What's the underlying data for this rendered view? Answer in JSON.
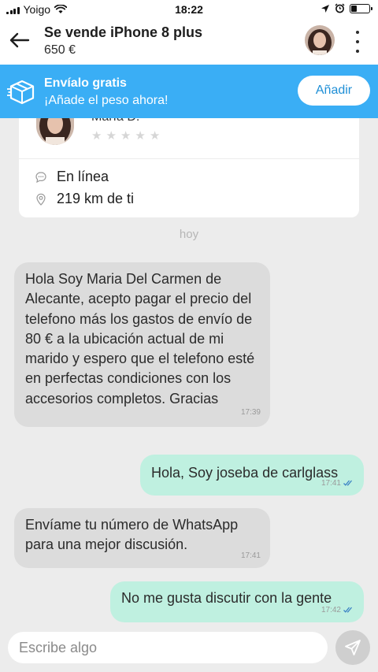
{
  "status_bar": {
    "carrier": "Yoigo",
    "time": "18:22"
  },
  "header": {
    "title": "Se vende iPhone 8 plus",
    "price": "650 €"
  },
  "banner": {
    "title": "Envíalo gratis",
    "subtitle": "¡Añade el peso ahora!",
    "button_label": "Añadir",
    "color": "#3aaef5"
  },
  "profile": {
    "name": "María D.",
    "rating_stars": 0,
    "status": "En línea",
    "distance": "219 km de ti"
  },
  "date_separator": "hoy",
  "messages": [
    {
      "direction": "in",
      "text": "Hola Soy Maria Del Carmen de Alecante, acepto pagar el precio del telefono más los gastos de envío de 80 € a la ubicación actual de mi marido y espero que el telefono esté en perfectas condiciones con los accesorios completos. Gracias",
      "time": "17:39"
    },
    {
      "direction": "out",
      "text": "Hola, Soy joseba de carlglass",
      "time": "17:41",
      "read": true
    },
    {
      "direction": "in",
      "text": "Envíame tu número de WhatsApp para una mejor discusión.",
      "time": "17:41"
    },
    {
      "direction": "out",
      "text": "No me gusta discutir con la gente",
      "time": "17:42",
      "read": true
    }
  ],
  "input": {
    "placeholder": "Escribe algo"
  },
  "colors": {
    "incoming_bubble": "#dcdcdc",
    "outgoing_bubble": "#bff0e0",
    "read_ticks": "#3b82c4"
  }
}
